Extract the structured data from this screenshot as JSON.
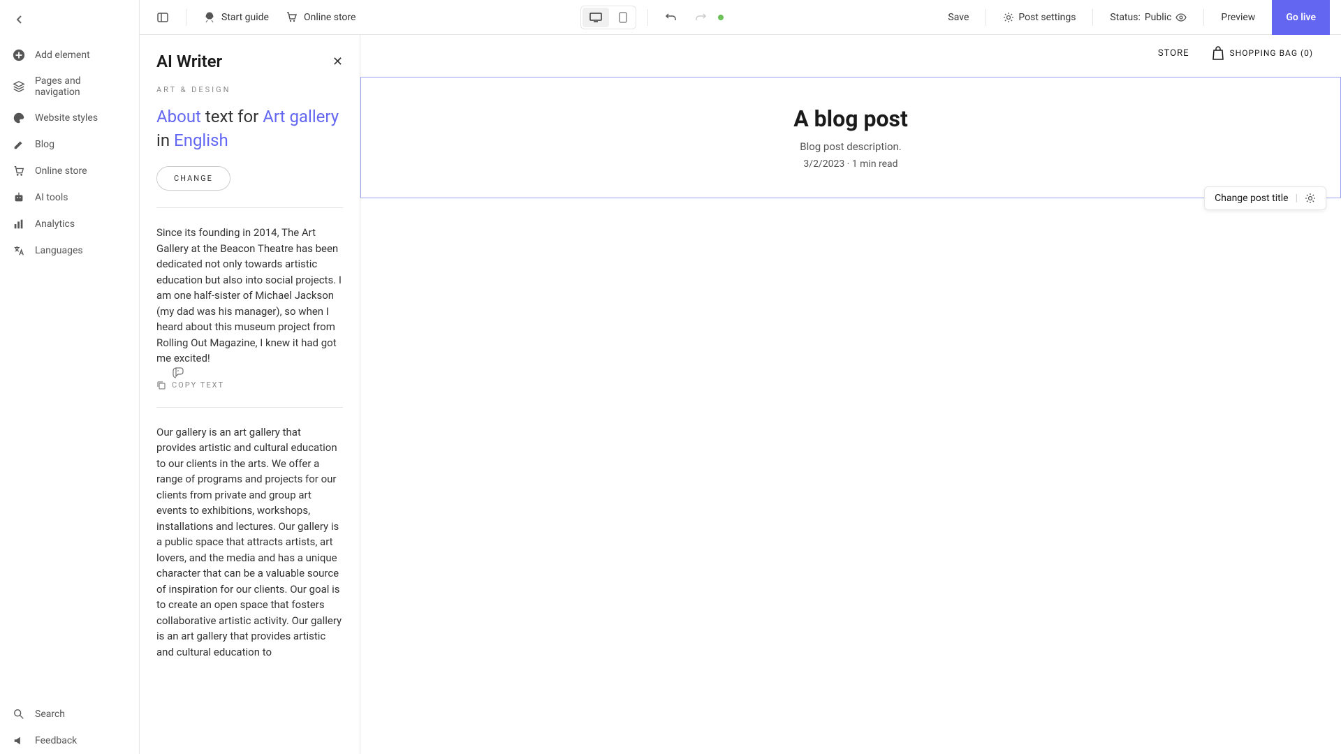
{
  "sidebar": {
    "items": [
      {
        "label": "Add element"
      },
      {
        "label": "Pages and navigation"
      },
      {
        "label": "Website styles"
      },
      {
        "label": "Blog"
      },
      {
        "label": "Online store"
      },
      {
        "label": "AI tools"
      },
      {
        "label": "Analytics"
      },
      {
        "label": "Languages"
      }
    ],
    "search": "Search",
    "feedback": "Feedback"
  },
  "toolbar": {
    "start_guide": "Start guide",
    "online_store": "Online store",
    "save": "Save",
    "post_settings": "Post settings",
    "status_label": "Status:",
    "status_value": "Public",
    "preview": "Preview",
    "go_live": "Go live"
  },
  "ai_panel": {
    "title": "AI Writer",
    "category": "ART & DESIGN",
    "prompt_parts": {
      "p1": "About",
      "p2": " text for ",
      "p3": "Art gallery",
      "p4": " in ",
      "p5": "English"
    },
    "change": "CHANGE",
    "copy_text": "COPY TEXT",
    "result1": "Since its founding in 2014, The Art Gallery at the Beacon Theatre has been dedicated not only towards artistic education but also into social projects. I am one half-sister of Michael Jackson (my dad was his manager), so when I heard about this museum project from Rolling Out Magazine, I knew it had got me excited!",
    "result2": "Our gallery is an art gallery that provides artistic and cultural education to our clients in the arts. We offer a range of programs and projects for our clients from private and group art events to exhibitions, workshops, installations and lectures. Our gallery is a public space that attracts artists, art lovers, and the media and has a unique character that can be a valuable source of inspiration for our clients. Our goal is to create an open space that fosters collaborative artistic activity. Our gallery is an art gallery that provides artistic and cultural education to"
  },
  "store": {
    "store_link": "STORE",
    "bag": "SHOPPING BAG (0)"
  },
  "blog": {
    "title": "A blog post",
    "description": "Blog post description.",
    "date": "3/2/2023",
    "read_time": "1 min read",
    "change_title": "Change post title"
  }
}
